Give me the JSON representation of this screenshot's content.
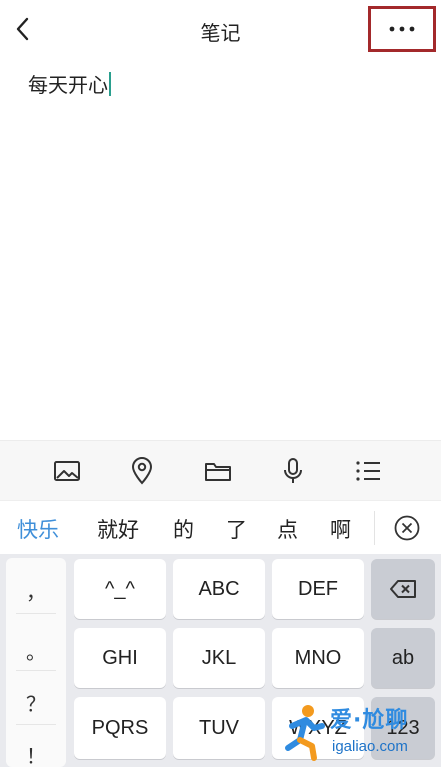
{
  "header": {
    "title": "笔记",
    "back_icon": "chevron-left-icon",
    "more_icon": "more-horizontal-icon",
    "highlight_color": "#a3292b"
  },
  "note": {
    "content": "每天开心",
    "caret_color": "#2a9f8e"
  },
  "toolbar": {
    "items": [
      {
        "icon": "image-icon"
      },
      {
        "icon": "location-icon"
      },
      {
        "icon": "folder-icon"
      },
      {
        "icon": "microphone-icon"
      },
      {
        "icon": "list-icon"
      }
    ]
  },
  "candidates": {
    "items": [
      "快乐",
      "就好",
      "的",
      "了",
      "点",
      "啊"
    ],
    "active_color": "#3f8fd9",
    "close_icon": "close-circle-icon"
  },
  "keyboard": {
    "punctuation": [
      "，",
      "。",
      "？",
      "！"
    ],
    "rows": [
      [
        "^_^",
        "ABC",
        "DEF"
      ],
      [
        "GHI",
        "JKL",
        "MNO"
      ],
      [
        "PQRS",
        "TUV",
        "WXYZ"
      ]
    ],
    "right_keys": {
      "backspace_icon": "backspace-icon",
      "ab_label": "ab",
      "num_label": "123"
    }
  },
  "watermark": {
    "main": "爱·尬聊",
    "sub": "igaliao.com"
  }
}
